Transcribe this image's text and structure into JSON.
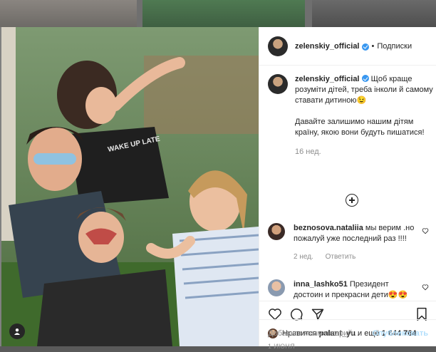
{
  "post": {
    "author": "zelenskiy_official",
    "follow_label": "Подписки",
    "caption_line1": "Щоб краще розуміти дітей, треба інколи й самому ставати дитиною😉",
    "caption_line2": "Давайте залишимо нашим дітям країну, якою вони будуть пишатися!",
    "caption_time": "16 нед.",
    "date": "1 ИЮНЯ"
  },
  "comments": [
    {
      "author": "beznosova.nataliia",
      "text": "мы верим .но пожалуй уже последний раз !!!!",
      "time": "2 нед.",
      "reply_label": "Ответить"
    },
    {
      "author": "inna_lashko51",
      "text": "Президент достоин и прекрасни дети😍😍"
    }
  ],
  "likes": {
    "prefix": "Нравится",
    "user": "palant_yu",
    "suffix": "и ещё",
    "count": "1 644 764"
  },
  "add_comment": {
    "placeholder": "Добавьте комментарий...",
    "publish_label": "Опубликовать"
  },
  "colors": {
    "accent": "#3897f0",
    "publish_disabled": "#b2dffc",
    "muted": "#8e8e8e"
  },
  "icons": [
    "heart-icon",
    "comment-icon",
    "share-icon",
    "bookmark-icon",
    "plus-circle-icon",
    "verified-badge-icon",
    "user-tag-icon"
  ]
}
